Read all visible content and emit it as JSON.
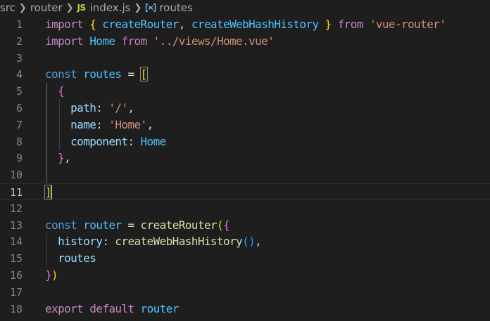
{
  "breadcrumb": {
    "items": [
      "src",
      "router",
      "index.js",
      "routes"
    ],
    "file_badge": "JS",
    "symbol_icon": "variable-symbol-icon"
  },
  "editor": {
    "current_line": 11,
    "line_numbers": [
      "1",
      "2",
      "3",
      "4",
      "5",
      "6",
      "7",
      "8",
      "9",
      "10",
      "11",
      "12",
      "13",
      "14",
      "15",
      "16",
      "17",
      "18"
    ],
    "lines": [
      [
        [
          "kw-ctrl",
          "import"
        ],
        [
          "plain",
          " "
        ],
        [
          "b1",
          "{"
        ],
        [
          "plain",
          " "
        ],
        [
          "var",
          "createRouter"
        ],
        [
          "plain",
          ", "
        ],
        [
          "var",
          "createWebHashHistory"
        ],
        [
          "plain",
          " "
        ],
        [
          "b1",
          "}"
        ],
        [
          "plain",
          " "
        ],
        [
          "kw-ctrl",
          "from"
        ],
        [
          "plain",
          " "
        ],
        [
          "str",
          "'vue-router'"
        ]
      ],
      [
        [
          "kw-ctrl",
          "import"
        ],
        [
          "plain",
          " "
        ],
        [
          "var",
          "Home"
        ],
        [
          "plain",
          " "
        ],
        [
          "kw-ctrl",
          "from"
        ],
        [
          "plain",
          " "
        ],
        [
          "str",
          "'../views/Home.vue'"
        ]
      ],
      [],
      [
        [
          "kw",
          "const"
        ],
        [
          "plain",
          " "
        ],
        [
          "var",
          "routes"
        ],
        [
          "plain",
          " = "
        ],
        [
          "b1m",
          "["
        ]
      ],
      [
        [
          "plain",
          "  "
        ],
        [
          "b2",
          "{"
        ]
      ],
      [
        [
          "plain",
          "    "
        ],
        [
          "prop",
          "path"
        ],
        [
          "plain",
          ": "
        ],
        [
          "str",
          "'/'"
        ],
        [
          "plain",
          ","
        ]
      ],
      [
        [
          "plain",
          "    "
        ],
        [
          "prop",
          "name"
        ],
        [
          "plain",
          ": "
        ],
        [
          "str",
          "'Home'"
        ],
        [
          "plain",
          ","
        ]
      ],
      [
        [
          "plain",
          "    "
        ],
        [
          "prop",
          "component"
        ],
        [
          "plain",
          ": "
        ],
        [
          "var",
          "Home"
        ]
      ],
      [
        [
          "plain",
          "  "
        ],
        [
          "b2",
          "}"
        ],
        [
          "plain",
          ","
        ]
      ],
      [],
      [
        [
          "b1m",
          "]"
        ]
      ],
      [],
      [
        [
          "kw",
          "const"
        ],
        [
          "plain",
          " "
        ],
        [
          "var",
          "router"
        ],
        [
          "plain",
          " = "
        ],
        [
          "fn",
          "createRouter"
        ],
        [
          "b1",
          "("
        ],
        [
          "b2",
          "{"
        ]
      ],
      [
        [
          "plain",
          "  "
        ],
        [
          "prop",
          "history"
        ],
        [
          "plain",
          ": "
        ],
        [
          "fn",
          "createWebHashHistory"
        ],
        [
          "b3",
          "()"
        ],
        [
          "plain",
          ","
        ]
      ],
      [
        [
          "plain",
          "  "
        ],
        [
          "prop",
          "routes"
        ]
      ],
      [
        [
          "b2",
          "}"
        ],
        [
          "b1",
          ")"
        ]
      ],
      [],
      [
        [
          "kw-ctrl",
          "export"
        ],
        [
          "plain",
          " "
        ],
        [
          "kw-ctrl",
          "default"
        ],
        [
          "plain",
          " "
        ],
        [
          "var",
          "router"
        ]
      ]
    ]
  },
  "colors": {
    "background": "#1e1e1e",
    "keyword_control": "#c586c0",
    "keyword": "#569cd6",
    "function": "#dcdcaa",
    "variable": "#4fc1ff",
    "property": "#9cdcfe",
    "string": "#ce9178",
    "bracket_1": "#ffd700",
    "bracket_2": "#da70d6",
    "bracket_3": "#179fff",
    "js_badge": "#cbcb41"
  }
}
